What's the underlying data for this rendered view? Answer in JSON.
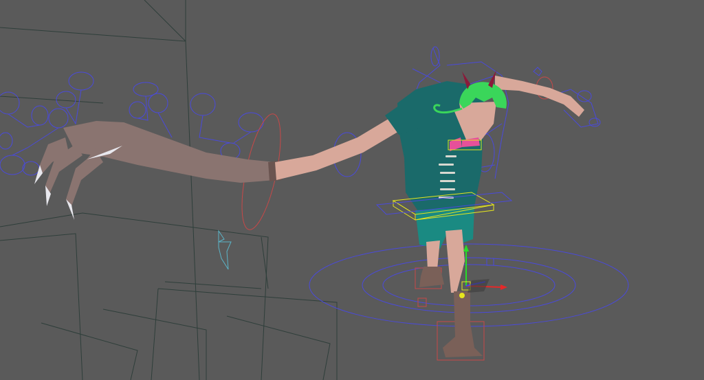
{
  "viewport": {
    "background": "#5a5a5a",
    "grid_color": "#3f4a46",
    "wire_color": "#2e3e3a"
  },
  "rig": {
    "fk_control_color": "#4a4adc",
    "ik_control_color": "#c84848",
    "selection_color": "#e6e61e",
    "locator_color": "#5ab4c8",
    "manipulator": {
      "x_axis_color": "#e62828",
      "y_axis_color": "#28dc28",
      "z_axis_color": "#3c3cff"
    }
  },
  "character": {
    "skin_color": "#d8a89a",
    "long_arm_color": "#8a7470",
    "shirt_color": "#1a6a6a",
    "shorts_color": "#1a8a82",
    "hair_color": "#3ad65a",
    "horn_color": "#8a1a3a",
    "bowtie_color": "#e6509a",
    "boot_color": "#7a6058",
    "claw_color": "#e8e8ee"
  }
}
